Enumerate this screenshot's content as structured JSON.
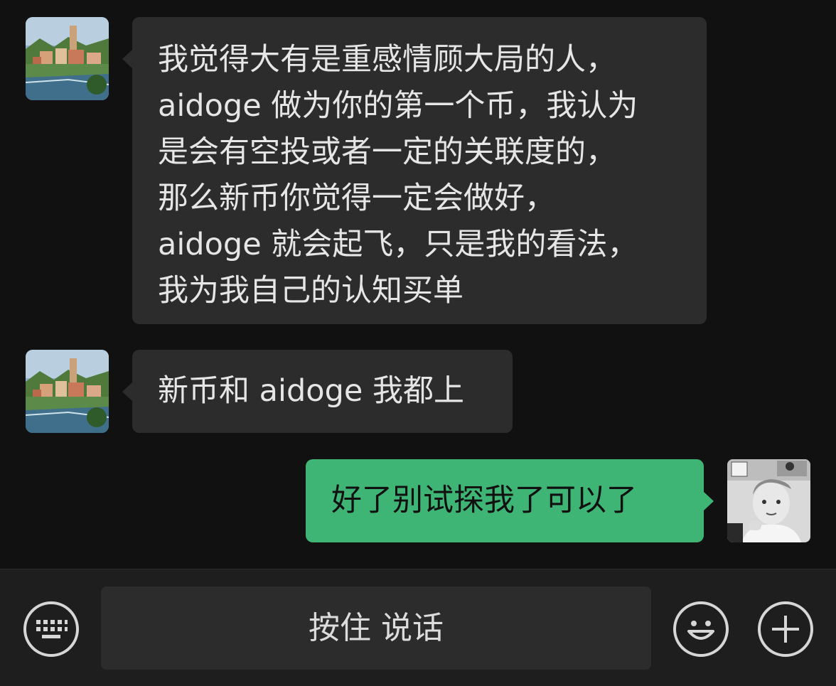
{
  "messages": [
    {
      "direction": "incoming",
      "lines": [
        "我觉得大有是重感情顾大局的人，",
        "aidoge 做为你的第一个币，我认为",
        "是会有空投或者一定的关联度的，",
        "那么新币你觉得一定会做好，",
        "aidoge 就会起飞，只是我的看法，",
        "我为我自己的认知买单"
      ]
    },
    {
      "direction": "incoming",
      "lines": [
        "新币和 aidoge 我都上"
      ]
    },
    {
      "direction": "outgoing",
      "lines": [
        "好了别试探我了可以了"
      ]
    }
  ],
  "input_bar": {
    "hold_to_talk_label": "按住 说话",
    "icons": [
      "keyboard-icon",
      "emoji-icon",
      "plus-icon"
    ]
  },
  "colors": {
    "background": "#111111",
    "incoming_bubble": "#2c2c2c",
    "outgoing_bubble": "#3eb575",
    "bottom_bar": "#1e1e1e"
  }
}
